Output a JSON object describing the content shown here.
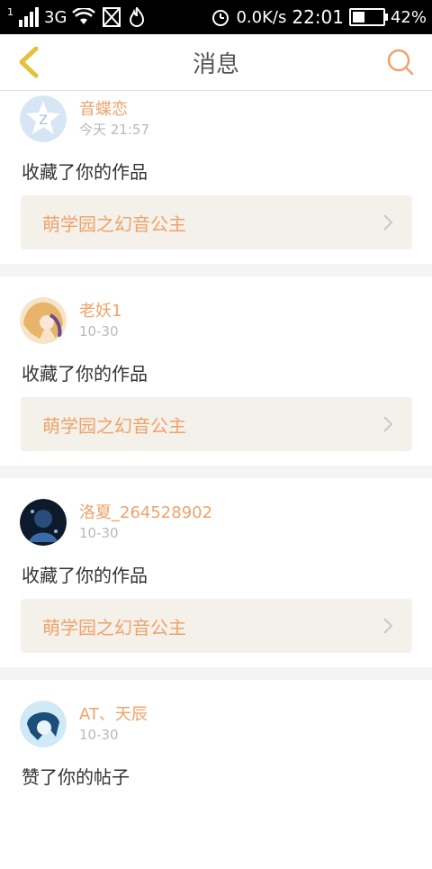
{
  "status_bar": {
    "sim": "1",
    "network": "3G",
    "speed": "0.0K/s",
    "time": "22:01",
    "battery": "42%",
    "battery_level": 0.42
  },
  "header": {
    "title": "消息"
  },
  "messages": [
    {
      "user": "音蝶恋",
      "time": "今天 21:57",
      "action": "收藏了你的作品",
      "work": "萌学园之幻音公主"
    },
    {
      "user": "老妖1",
      "time": "10-30",
      "action": "收藏了你的作品",
      "work": "萌学园之幻音公主"
    },
    {
      "user": "洛夏_264528902",
      "time": "10-30",
      "action": "收藏了你的作品",
      "work": "萌学园之幻音公主"
    },
    {
      "user": "AT、天辰",
      "time": "10-30",
      "action": "赞了你的帖子",
      "work": ""
    }
  ],
  "colors": {
    "accent": "#f0a26a",
    "back_icon": "#e6c23a"
  }
}
